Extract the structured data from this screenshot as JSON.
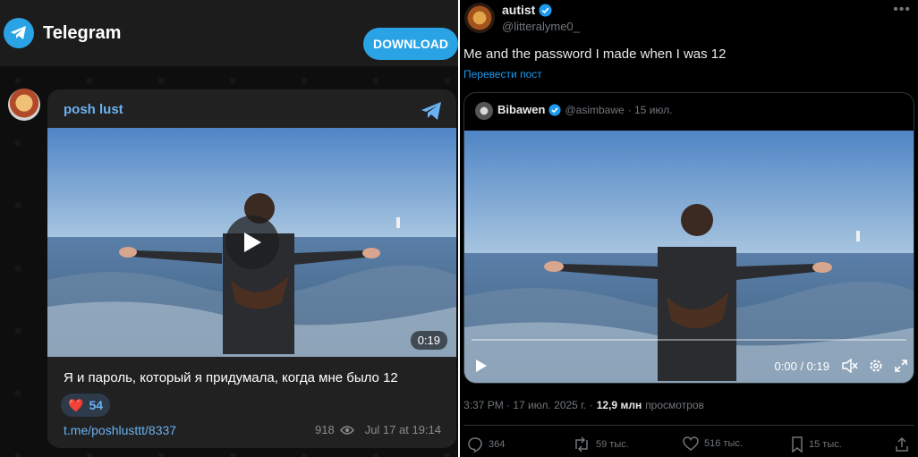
{
  "telegram": {
    "app_title": "Telegram",
    "download_label": "DOWNLOAD",
    "channel_name": "posh lust",
    "video_duration": "0:19",
    "caption": "Я и пароль, который я придумала, когда мне было 12",
    "reaction": {
      "emoji": "❤️",
      "count": "54"
    },
    "post_link": "t.me/poshlusttt/8337",
    "views": "918",
    "timestamp": "Jul 17 at 19:14",
    "accent": "#2aa3e4",
    "link_color": "#6ab2f2"
  },
  "x_post": {
    "author_name": "autist",
    "author_handle": "@litteralyme0_",
    "text": "Me and the password I made when I was 12",
    "translate_label": "Перевести пост",
    "quote": {
      "author_name": "Bibawen",
      "author_handle": "@asimbawe",
      "date": "· 15 июл.",
      "time_display": "0:00 / 0:19"
    },
    "post_time": "3:37 PM · 17 июл. 2025 г. ·",
    "views_count": "12,9 млн",
    "views_label": "просмотров",
    "actions": {
      "replies": "364",
      "reposts": "59 тыс.",
      "likes": "516 тыс.",
      "bookmarks": "15 тыс."
    },
    "verified_color": "#1d9bf0"
  }
}
